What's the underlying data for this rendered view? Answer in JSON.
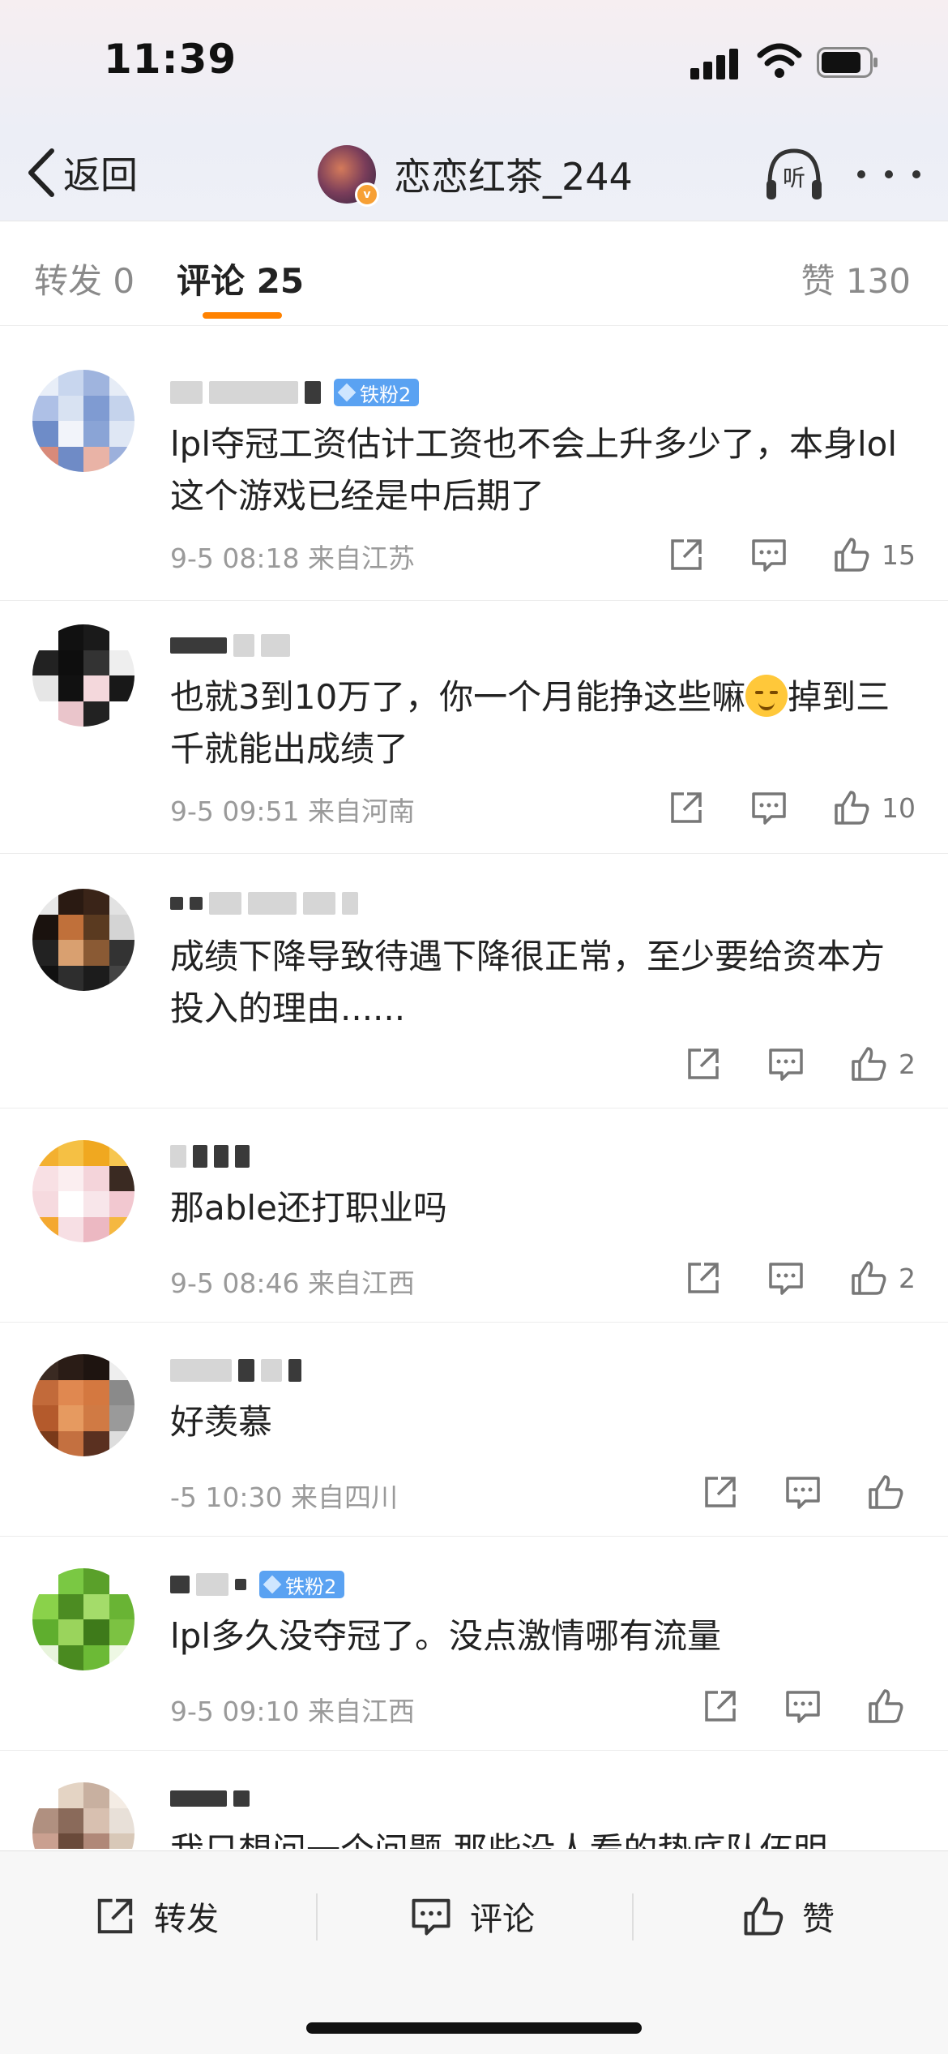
{
  "status_bar": {
    "time": "11:39"
  },
  "nav": {
    "back_label": "返回",
    "title": "恋恋红茶_244",
    "listen_label": "听"
  },
  "tabs": [
    {
      "label": "转发 0"
    },
    {
      "label": "评论 25"
    },
    {
      "label": "赞 130"
    }
  ],
  "comments": [
    {
      "name": "",
      "badge": "铁粉2",
      "text": "lpl夺冠工资估计工资也不会上升多少了，本身lol这个游戏已经是中后期了",
      "time": "9-5 08:18",
      "location": "来自江苏",
      "likes": "15"
    },
    {
      "name": "",
      "badge": "",
      "text_before": "也就3到10万了，你一个月能挣这些嘛",
      "text_after": "掉到三千就能出成绩了",
      "time": "9-5 09:51",
      "location": "来自河南",
      "likes": "10"
    },
    {
      "name": "",
      "badge": "",
      "text": "成绩下降导致待遇下降很正常，至少要给资本方投入的理由......",
      "time": "",
      "location": "",
      "likes": "2"
    },
    {
      "name": "",
      "badge": "",
      "text": "那able还打职业吗",
      "time": "9-5 08:46",
      "location": "来自江西",
      "likes": "2"
    },
    {
      "name": "",
      "badge": "",
      "text": "好羡慕",
      "time": "-5 10:30",
      "location": "来自四川",
      "likes": ""
    },
    {
      "name": "",
      "badge": "铁粉2",
      "text": "lpl多久没夺冠了。没点激情哪有流量",
      "time": "9-5 09:10",
      "location": "来自江西",
      "likes": ""
    },
    {
      "name": "",
      "badge": "",
      "text": "我只想问一个问题 那些没人看的垫底队伍明",
      "time": "",
      "location": "",
      "likes": ""
    }
  ],
  "bottom_bar": {
    "repost_label": "转发",
    "comment_label": "评论",
    "like_label": "赞"
  },
  "colors": {
    "accent": "#ff8200",
    "badge": "#5aa2f2",
    "meta_text": "#9a9a9a"
  }
}
